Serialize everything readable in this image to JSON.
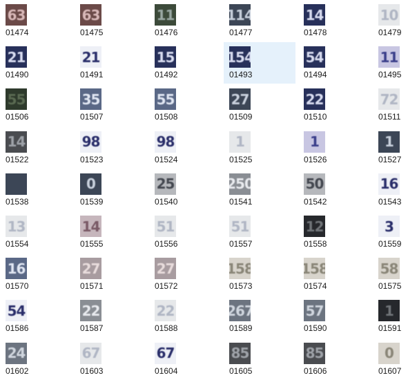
{
  "files": [
    {
      "name": "01474",
      "digits": "63",
      "theme": "t-brown"
    },
    {
      "name": "01475",
      "digits": "63",
      "theme": "t-brown"
    },
    {
      "name": "01476",
      "digits": "11",
      "theme": "t-green"
    },
    {
      "name": "01477",
      "digits": "114",
      "theme": "t-slate"
    },
    {
      "name": "01478",
      "digits": "14",
      "theme": "t-navy"
    },
    {
      "name": "01479",
      "digits": "10",
      "theme": "t-pale"
    },
    {
      "name": "01490",
      "digits": "21",
      "theme": "t-navy"
    },
    {
      "name": "01491",
      "digits": "21",
      "theme": "t-white"
    },
    {
      "name": "01492",
      "digits": "15",
      "theme": "t-navy"
    },
    {
      "name": "01493",
      "digits": "154",
      "theme": "t-navy",
      "selected": true
    },
    {
      "name": "01494",
      "digits": "54",
      "theme": "t-navy"
    },
    {
      "name": "01495",
      "digits": "11",
      "theme": "t-lav"
    },
    {
      "name": "01506",
      "digits": "55",
      "theme": "t-olive"
    },
    {
      "name": "01507",
      "digits": "35",
      "theme": "t-blueg"
    },
    {
      "name": "01508",
      "digits": "55",
      "theme": "t-blueg"
    },
    {
      "name": "01509",
      "digits": "27",
      "theme": "t-slate"
    },
    {
      "name": "01510",
      "digits": "22",
      "theme": "t-navy"
    },
    {
      "name": "01511",
      "digits": "72",
      "theme": "t-pale"
    },
    {
      "name": "01522",
      "digits": "14",
      "theme": "t-char"
    },
    {
      "name": "01523",
      "digits": "98",
      "theme": "t-white"
    },
    {
      "name": "01524",
      "digits": "98",
      "theme": "t-white"
    },
    {
      "name": "01525",
      "digits": "1",
      "theme": "t-pale"
    },
    {
      "name": "01526",
      "digits": "1",
      "theme": "t-lav"
    },
    {
      "name": "01527",
      "digits": "1",
      "theme": "t-slate"
    },
    {
      "name": "01538",
      "digits": "",
      "theme": "t-slate"
    },
    {
      "name": "01539",
      "digits": "0",
      "theme": "t-slate"
    },
    {
      "name": "01540",
      "digits": "25",
      "theme": "t-lightg"
    },
    {
      "name": "01541",
      "digits": "250",
      "theme": "t-gray"
    },
    {
      "name": "01542",
      "digits": "50",
      "theme": "t-lightg"
    },
    {
      "name": "01543",
      "digits": "16",
      "theme": "t-white"
    },
    {
      "name": "01554",
      "digits": "13",
      "theme": "t-pale"
    },
    {
      "name": "01555",
      "digits": "14",
      "theme": "t-rose"
    },
    {
      "name": "01556",
      "digits": "51",
      "theme": "t-pale"
    },
    {
      "name": "01557",
      "digits": "51",
      "theme": "t-pale"
    },
    {
      "name": "01558",
      "digits": "12",
      "theme": "t-dark"
    },
    {
      "name": "01559",
      "digits": "3",
      "theme": "t-white"
    },
    {
      "name": "01570",
      "digits": "16",
      "theme": "t-blueg"
    },
    {
      "name": "01571",
      "digits": "27",
      "theme": "t-mauve"
    },
    {
      "name": "01572",
      "digits": "27",
      "theme": "t-mauve"
    },
    {
      "name": "01573",
      "digits": "158",
      "theme": "t-cream"
    },
    {
      "name": "01574",
      "digits": "158",
      "theme": "t-cream"
    },
    {
      "name": "01575",
      "digits": "58",
      "theme": "t-cream"
    },
    {
      "name": "01586",
      "digits": "54",
      "theme": "t-white"
    },
    {
      "name": "01587",
      "digits": "22",
      "theme": "t-gray"
    },
    {
      "name": "01588",
      "digits": "22",
      "theme": "t-pale"
    },
    {
      "name": "01589",
      "digits": "267",
      "theme": "t-steel"
    },
    {
      "name": "01590",
      "digits": "57",
      "theme": "t-steel"
    },
    {
      "name": "01591",
      "digits": "1",
      "theme": "t-dark"
    },
    {
      "name": "01602",
      "digits": "24",
      "theme": "t-steel"
    },
    {
      "name": "01603",
      "digits": "67",
      "theme": "t-pale"
    },
    {
      "name": "01604",
      "digits": "67",
      "theme": "t-white"
    },
    {
      "name": "01605",
      "digits": "85",
      "theme": "t-char"
    },
    {
      "name": "01606",
      "digits": "85",
      "theme": "t-char"
    },
    {
      "name": "01607",
      "digits": "0",
      "theme": "t-cream"
    }
  ]
}
